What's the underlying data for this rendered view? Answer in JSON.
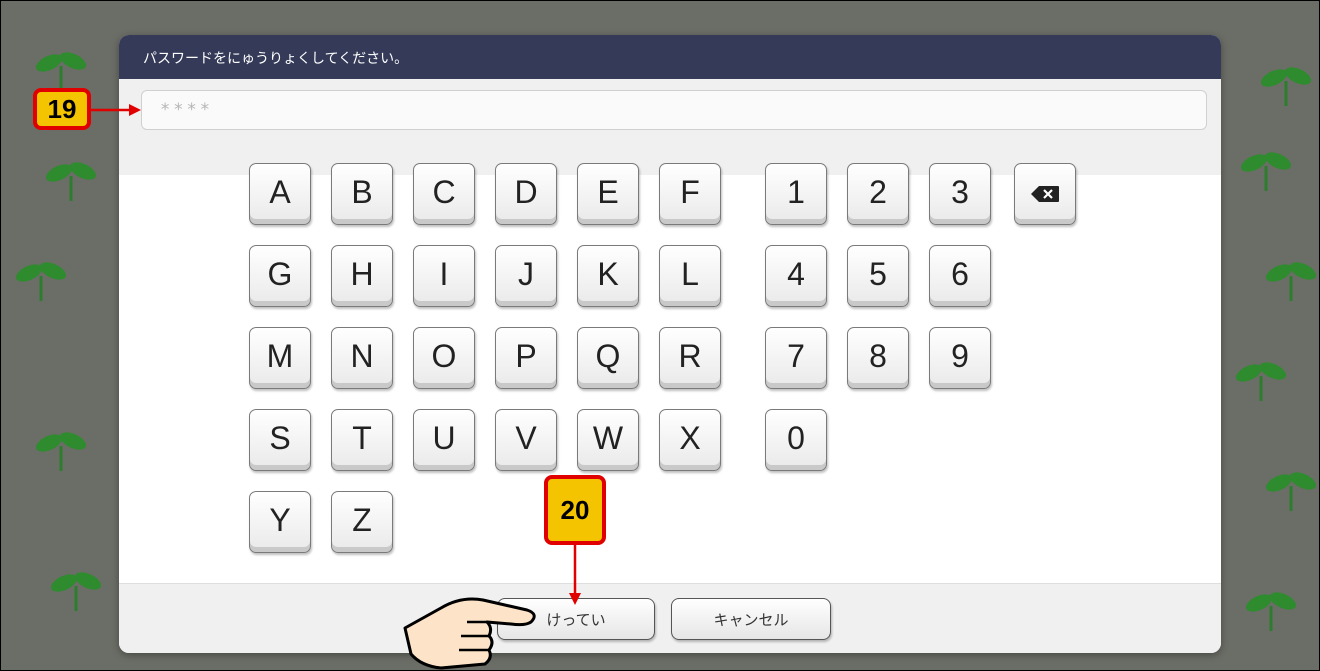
{
  "dialog": {
    "title": "パスワードをにゅうりょくしてください。",
    "password_value": "****"
  },
  "keyboard": {
    "letter_rows": [
      [
        "A",
        "B",
        "C",
        "D",
        "E",
        "F"
      ],
      [
        "G",
        "H",
        "I",
        "J",
        "K",
        "L"
      ],
      [
        "M",
        "N",
        "O",
        "P",
        "Q",
        "R"
      ],
      [
        "S",
        "T",
        "U",
        "V",
        "W",
        "X"
      ],
      [
        "Y",
        "Z"
      ]
    ],
    "number_rows": [
      [
        "1",
        "2",
        "3"
      ],
      [
        "4",
        "5",
        "6"
      ],
      [
        "7",
        "8",
        "9"
      ],
      [
        "0"
      ]
    ],
    "backspace_icon": "backspace-icon"
  },
  "buttons": {
    "confirm_label": "けってい",
    "cancel_label": "キャンセル"
  },
  "annotations": {
    "step_19": "19",
    "step_20": "20"
  },
  "colors": {
    "header": "#343a58",
    "badge_fill": "#f5c400",
    "badge_border": "#e00000",
    "background": "#6b6e66"
  }
}
